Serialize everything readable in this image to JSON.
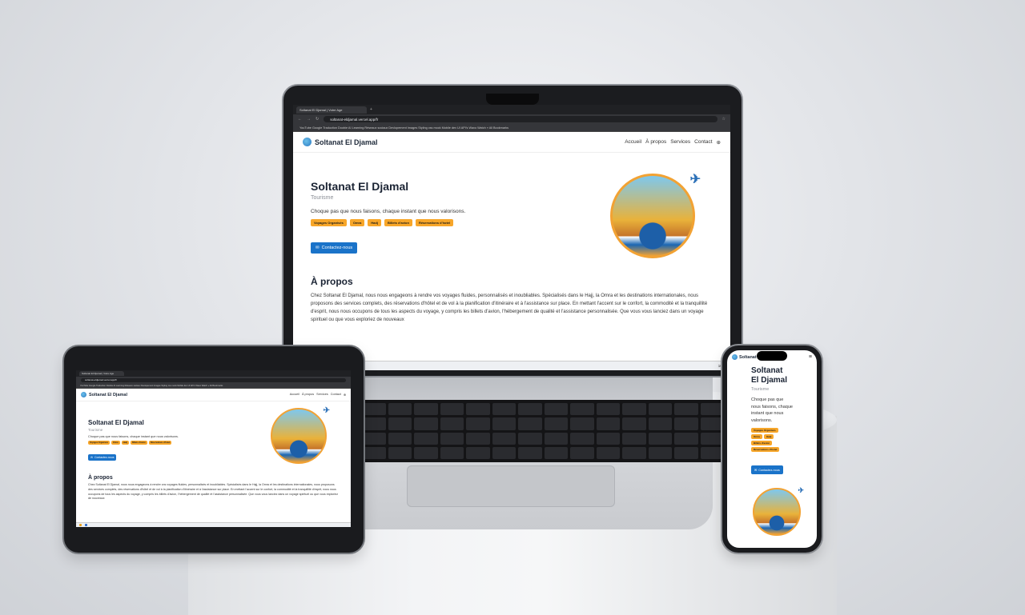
{
  "site": {
    "brand": "Soltanat El Djamal",
    "nav": [
      "Accueil",
      "À propos",
      "Services",
      "Contact"
    ],
    "hero_title": "Soltanat El Djamal",
    "hero_title_phone_line1": "Soltanat",
    "hero_title_phone_line2": "El Djamal",
    "subtitle": "Tourisme",
    "tagline": "Choque pas que nous faisons, chaque instant que nous valorisons.",
    "tags": [
      "Voyages Organisés",
      "Omra",
      "Hadj",
      "Billets d'avion",
      "Réservations d'hotel"
    ],
    "contact_button": "Contactez-nous",
    "about_title": "À propos",
    "about_text": "Chez Soltanat El Djamal, nous nous engageons à rendre vos voyages fluides, personnalisés et inoubliables. Spécialisés dans le Hajj, la Omra et les destinations internationales, nous proposons des services complets, des réservations d'hôtel et de vol à la planification d'itinéraire et à l'assistance sur place. En mettant l'accent sur le confort, la commodité et la tranquillité d'esprit, nous nous occupons de tous les aspects du voyage, y compris les billets d'avion, l'hébergement de qualité et l'assistance personnalisée. Que vous vous lanciez dans un voyage spirituel ou que vous exploriez de nouveaux"
  },
  "browser": {
    "tab_title": "Soltanat El Djamal | Votre Age",
    "url": "soltanat-eldjamal.vercel.app/fr",
    "bookmarks": "YouTube   Google Traduction   Doobie   AI   Learning   Réseaux sociaux   Devlopement   Images   Styling css   mock   Mobile dev   UI   API's   Waxo Watch   »   All Bookmarks",
    "clock": "16:18"
  },
  "logo_text": "Soltanat El Djamal",
  "colors": {
    "accent": "#f7a629",
    "button": "#1a73c9",
    "heading": "#1b2434"
  }
}
